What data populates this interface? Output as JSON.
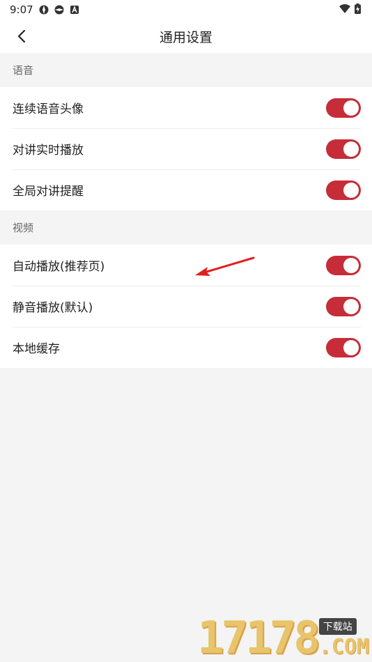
{
  "status_bar": {
    "time": "9:07"
  },
  "nav": {
    "title": "通用设置"
  },
  "sections": [
    {
      "header": "语音",
      "items": [
        {
          "label": "连续语音头像",
          "enabled": true
        },
        {
          "label": "对讲实时播放",
          "enabled": true
        },
        {
          "label": "全局对讲提醒",
          "enabled": true
        }
      ]
    },
    {
      "header": "视频",
      "items": [
        {
          "label": "自动播放(推荐页)",
          "enabled": true
        },
        {
          "label": "静音播放(默认)",
          "enabled": true
        },
        {
          "label": "本地缓存",
          "enabled": true
        }
      ]
    }
  ],
  "colors": {
    "accent": "#c62d38",
    "background": "#f4f4f4"
  },
  "watermark": {
    "number": "17178",
    "tag": "下载站",
    "suffix": ".COM"
  }
}
